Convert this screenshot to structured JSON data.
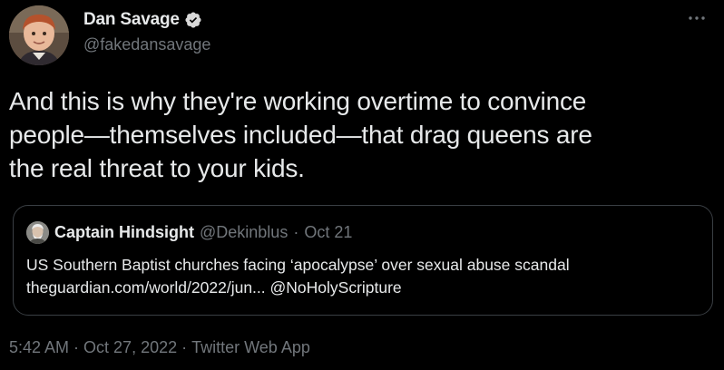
{
  "author": {
    "display_name": "Dan Savage",
    "handle": "@fakedansavage",
    "verified": true,
    "avatar_icon": "avatar-photo"
  },
  "tweet": {
    "text_lines": [
      "And this is why they're working overtime to convince",
      "people—themselves included—that drag queens are",
      "the real threat to your kids."
    ]
  },
  "quoted_tweet": {
    "display_name": "Captain Hindsight",
    "handle": "@Dekinblus",
    "separator": "·",
    "date": "Oct 21",
    "body_lines": [
      "US Southern Baptist churches facing ‘apocalypse’ over sexual abuse scandal",
      "theguardian.com/world/2022/jun... @NoHolyScripture"
    ]
  },
  "meta": {
    "time": "5:42 AM",
    "date": "Oct 27, 2022",
    "separator": "·",
    "source": "Twitter Web App"
  },
  "colors": {
    "background": "#000000",
    "text_primary": "#e7e9ea",
    "text_secondary": "#71767b",
    "verified_badge": "#d9d9d9",
    "card_border": "#3a3f44"
  },
  "icons": {
    "more": "more-horizontal-icon",
    "verified": "verified-badge-icon"
  }
}
